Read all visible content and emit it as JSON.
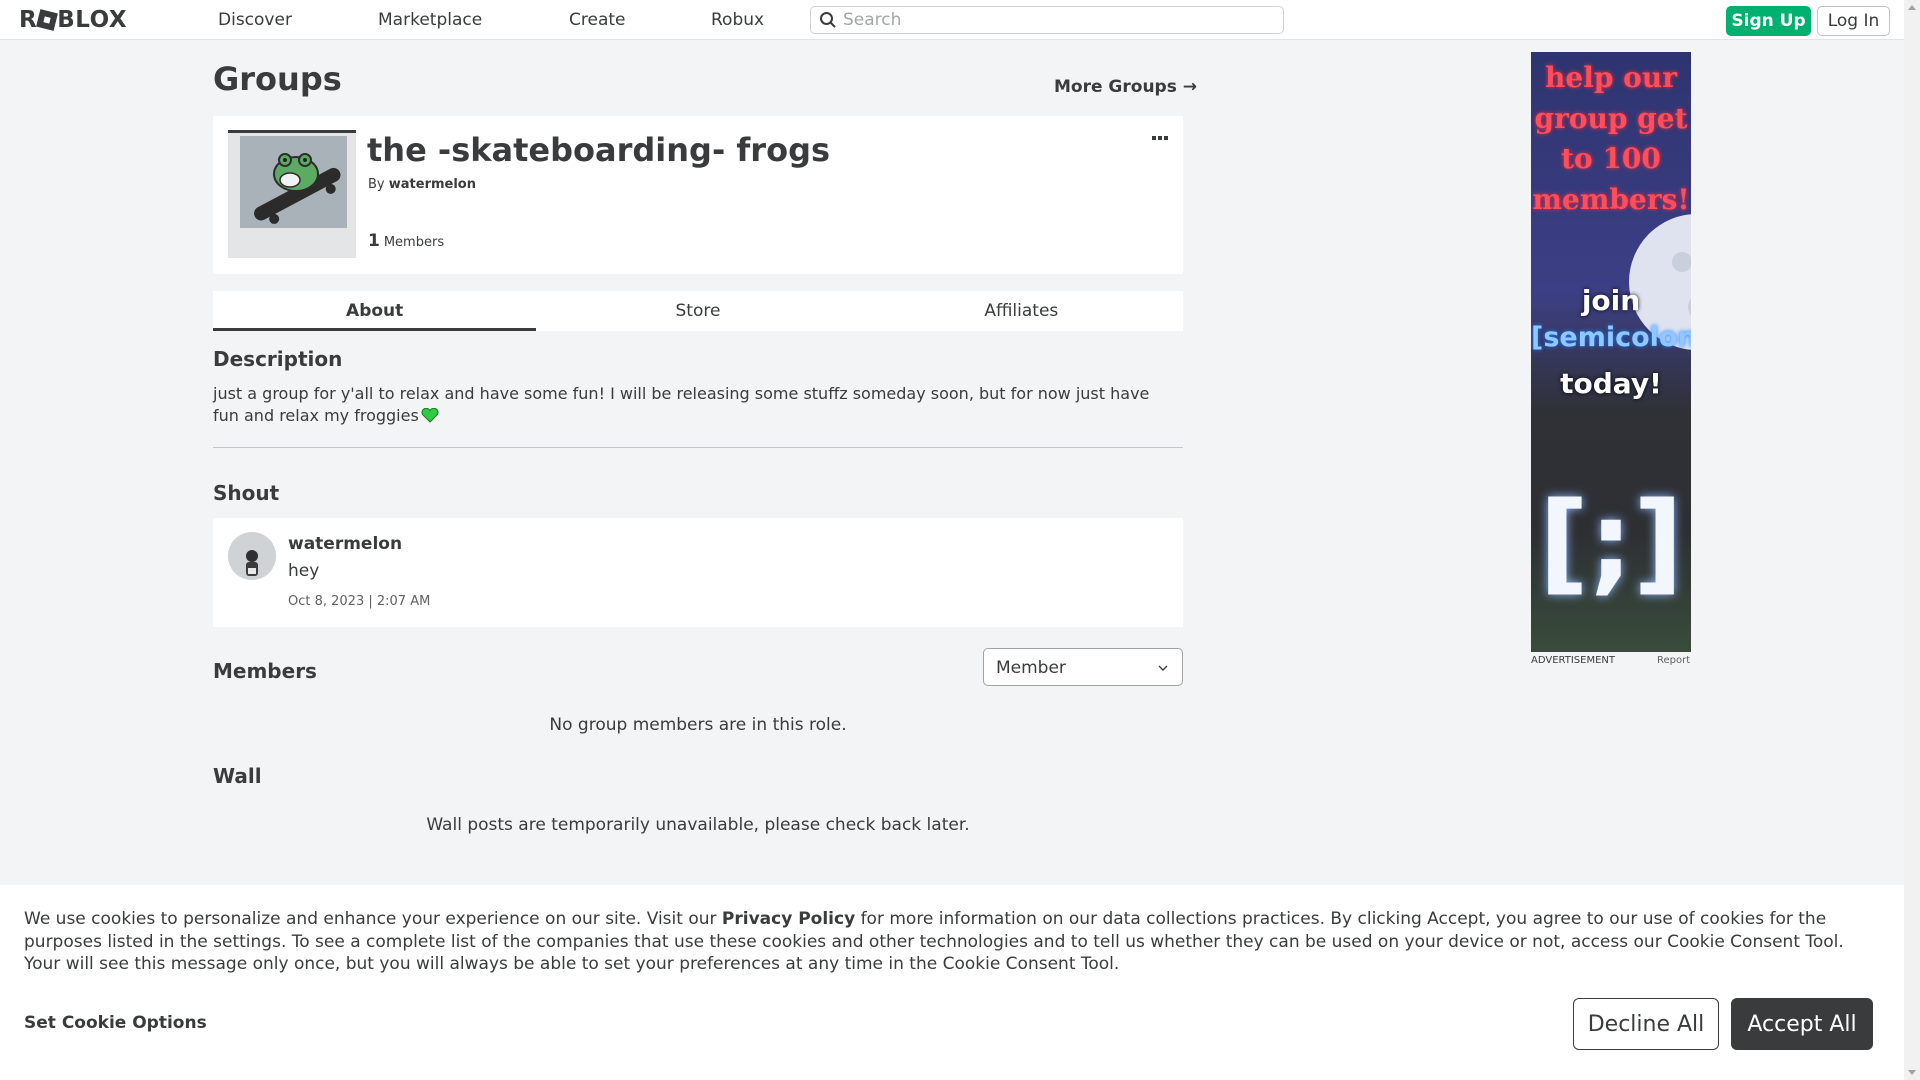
{
  "nav": {
    "logo": "ROBLOX",
    "links": [
      "Discover",
      "Marketplace",
      "Create",
      "Robux"
    ],
    "search_placeholder": "Search",
    "signup": "Sign Up",
    "login": "Log In"
  },
  "page": {
    "title": "Groups",
    "more_groups": "More Groups →"
  },
  "group": {
    "name": "the -skateboarding- frogs",
    "by_prefix": "By",
    "owner": "watermelon",
    "member_count": "1",
    "members_label": "Members"
  },
  "tabs": [
    "About",
    "Store",
    "Affiliates"
  ],
  "about": {
    "description_heading": "Description",
    "description": "just a group for y'all to relax and have some fun! I will be releasing some stuffz someday soon, but for now just have fun and relax my froggies"
  },
  "shout": {
    "heading": "Shout",
    "user": "watermelon",
    "body": "hey",
    "date": "Oct 8, 2023 | 2:07 AM"
  },
  "members": {
    "heading": "Members",
    "role_selected": "Member",
    "empty": "No group members are in this role."
  },
  "wall": {
    "heading": "Wall",
    "message": "Wall posts are temporarily unavailable, please check back later."
  },
  "ad": {
    "line1": "help our",
    "line2": "group get",
    "line3": "to 100",
    "line4": "members!",
    "line5": "join",
    "line6": "[semicolon]",
    "line7": "today!",
    "logo_text": "[;]",
    "label": "ADVERTISEMENT",
    "report": "Report"
  },
  "cookie": {
    "text_before": "We use cookies to personalize and enhance your experience on our site. Visit our ",
    "policy_link": "Privacy Policy",
    "text_after": " for more information on our data collections practices. By clicking Accept, you agree to our use of cookies for the purposes listed in the settings. To see a complete list of the companies that use these cookies and other technologies and to tell us whether they can be used on your device or not, access our Cookie Consent Tool. Your will see this message only once, but you will always be able to set your preferences at any time in the Cookie Consent Tool.",
    "set_options": "Set Cookie Options",
    "decline": "Decline All",
    "accept": "Accept All"
  },
  "colors": {
    "signup_green": "#00b06f",
    "text_dark": "#393b3d",
    "background": "#f2f4f5",
    "accept_bg": "#393b3d"
  }
}
